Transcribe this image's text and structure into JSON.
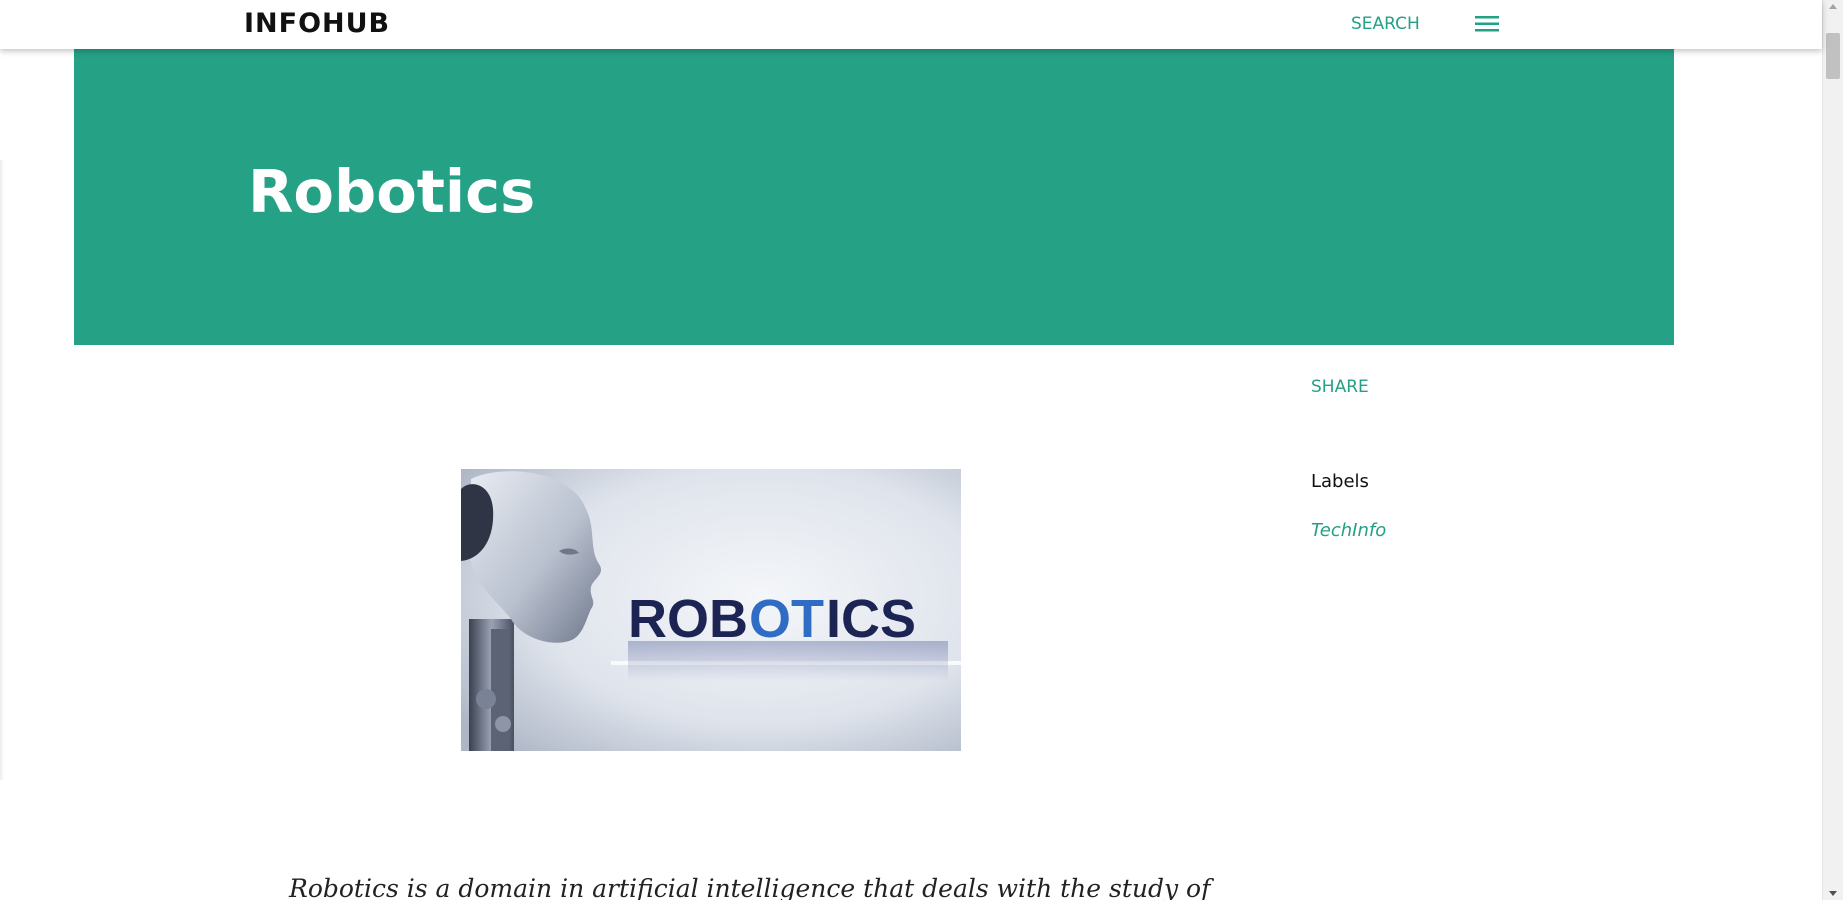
{
  "header": {
    "brand": "INFOHUB",
    "search_label": "SEARCH",
    "menu_icon": "hamburger-menu-icon"
  },
  "hero": {
    "title": "Robotics"
  },
  "sidebar": {
    "share_label": "SHARE",
    "labels_heading": "Labels",
    "labels": [
      "TechInfo"
    ]
  },
  "post": {
    "image_text": "ROBOTICS",
    "excerpt": "Robotics is a domain in artificial intelligence that deals with the study of"
  },
  "colors": {
    "accent": "#24a085",
    "hero_bg": "#25a186",
    "text": "#111111"
  }
}
